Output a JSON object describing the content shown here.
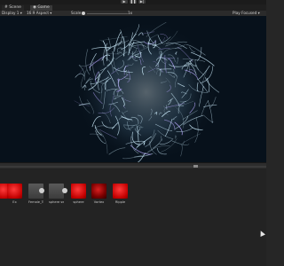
{
  "toolbar": {
    "play_icon": "play-icon",
    "pause_icon": "pause-icon",
    "step_icon": "step-icon"
  },
  "tabs": [
    {
      "label": "Scene",
      "active": false
    },
    {
      "label": "Game",
      "active": true
    }
  ],
  "game_toolbar": {
    "display": "Display 1",
    "aspect": "16:9 Aspect",
    "scale_label": "Scale",
    "scale_value": "1x",
    "play_mode": "Play Focused"
  },
  "assets": [
    {
      "label": "",
      "thumb": "red"
    },
    {
      "label": "Ex",
      "thumb": "red"
    },
    {
      "label": "Female_Tr...",
      "thumb": "gray"
    },
    {
      "label": "sphere sw...",
      "thumb": "gray"
    },
    {
      "label": "sphere",
      "thumb": "red"
    },
    {
      "label": "Vortex",
      "thumb": "dark"
    },
    {
      "label": "Ripple",
      "thumb": "red"
    }
  ],
  "colors": {
    "accent_red": "#e01b1b",
    "viewport_bg": "#07111b",
    "particles": "#cfefff"
  }
}
